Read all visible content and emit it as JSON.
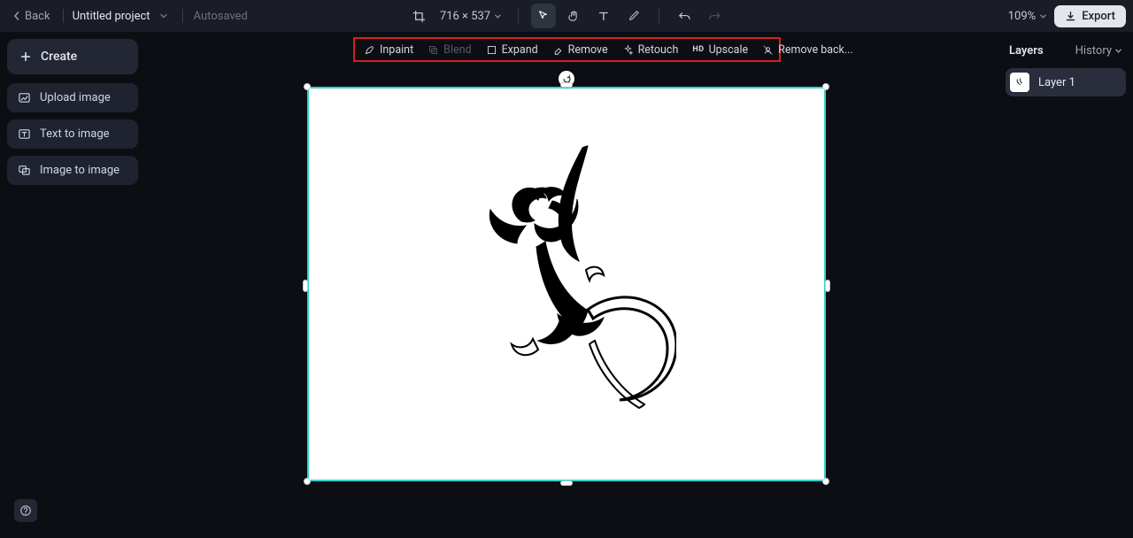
{
  "header": {
    "back_label": "Back",
    "project_title": "Untitled project",
    "autosaved_label": "Autosaved",
    "dimensions": "716 × 537",
    "zoom": "109%",
    "export_label": "Export"
  },
  "left_sidebar": {
    "create_label": "Create",
    "items": [
      {
        "label": "Upload image"
      },
      {
        "label": "Text to image"
      },
      {
        "label": "Image to image"
      }
    ]
  },
  "context_toolbar": {
    "items": [
      {
        "label": "Inpaint",
        "disabled": false
      },
      {
        "label": "Blend",
        "disabled": true
      },
      {
        "label": "Expand",
        "disabled": false
      },
      {
        "label": "Remove",
        "disabled": false
      },
      {
        "label": "Retouch",
        "disabled": false
      },
      {
        "label": "Upscale",
        "disabled": false
      },
      {
        "label": "Remove back...",
        "disabled": false
      }
    ]
  },
  "right_panel": {
    "title": "Layers",
    "history_label": "History",
    "layers": [
      {
        "label": "Layer 1"
      }
    ]
  }
}
